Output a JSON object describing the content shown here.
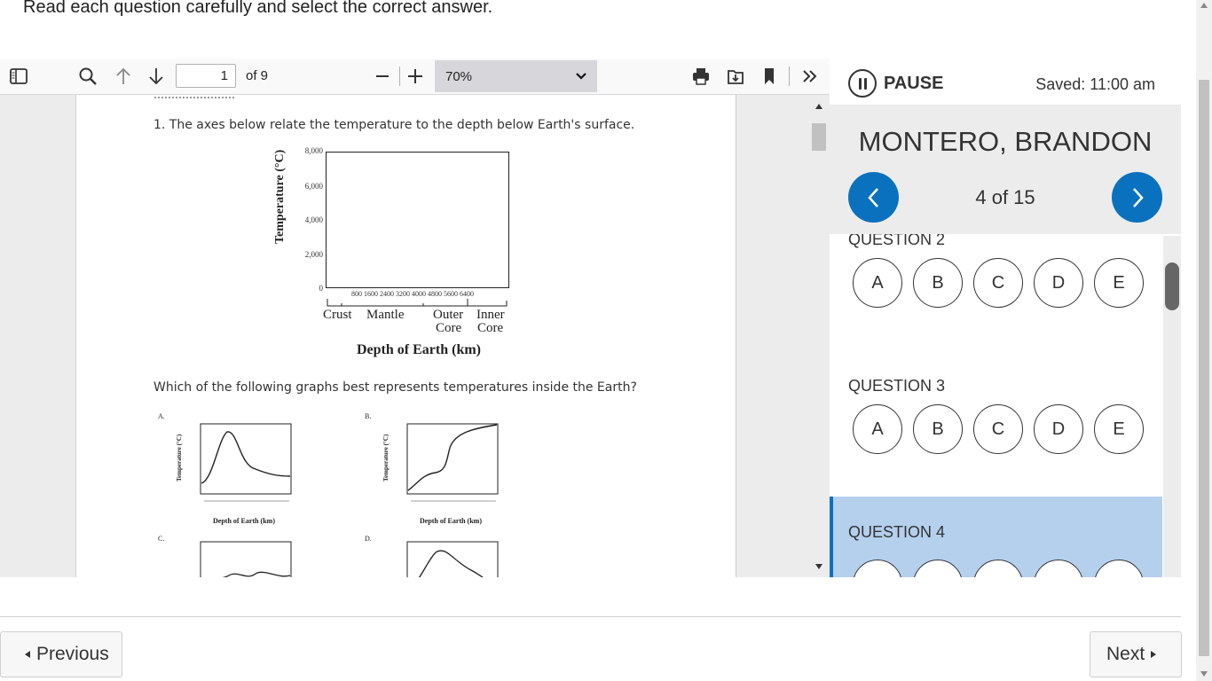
{
  "instructions": "Read each question carefully and select the correct answer.",
  "pdf_toolbar": {
    "page_number": "1",
    "page_count": "of 9",
    "zoom": "70%",
    "icons": [
      "sidebar-toggle-icon",
      "search-icon",
      "arrow-up-icon",
      "arrow-down-icon",
      "zoom-out-icon",
      "zoom-in-icon",
      "print-icon",
      "save-icon",
      "bookmark-icon",
      "more-tools-icon"
    ]
  },
  "document": {
    "question_stem": "1.  The axes below relate the temperature to the depth below Earth's surface.",
    "question_ask": "Which of the following graphs best represents temperatures inside the Earth?",
    "axes": {
      "y_label": "Temperature (°C)",
      "y_ticks": [
        "8,000",
        "6,000",
        "4,000",
        "2,000",
        "0"
      ],
      "x_ticks": "800  1600  2400  3200  4000  4800  5600  6400",
      "layers": [
        "Crust",
        "Mantle",
        "Outer",
        "Inner",
        "Core",
        "Core"
      ],
      "x_label": "Depth of Earth (km)"
    },
    "options": [
      {
        "letter": "A.",
        "caption": "Depth of Earth (km)"
      },
      {
        "letter": "B.",
        "caption": "Depth of Earth (km)"
      },
      {
        "letter": "C.",
        "caption": ""
      },
      {
        "letter": "D.",
        "caption": ""
      }
    ],
    "mini_y_label": "Temperature (°C)"
  },
  "panel": {
    "pause_label": "PAUSE",
    "saved": "Saved: 11:00 am",
    "student_name": "MONTERO, BRANDON",
    "progress": "4 of 15",
    "questions": [
      {
        "title": "QUESTION 2",
        "choices": [
          "A",
          "B",
          "C",
          "D",
          "E"
        ]
      },
      {
        "title": "QUESTION 3",
        "choices": [
          "A",
          "B",
          "C",
          "D",
          "E"
        ]
      },
      {
        "title": "QUESTION 4",
        "choices": [
          "",
          "",
          "",
          "",
          ""
        ]
      }
    ]
  },
  "footer": {
    "previous_label": "Previous",
    "next_label": "Next"
  },
  "colors": {
    "accent": "#0a71bf",
    "current_question_bg": "#b5d0ed",
    "band_bg": "#ececec"
  }
}
